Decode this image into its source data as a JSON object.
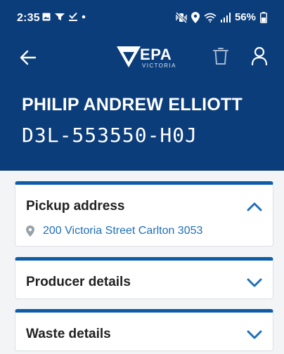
{
  "status_bar": {
    "time": "2:35",
    "battery": "56%",
    "left_icons": [
      "image-icon",
      "filter-icon",
      "check-download-icon",
      "dot-icon"
    ],
    "right_icons": [
      "mute-vibrate-icon",
      "location-icon",
      "wifi-icon",
      "signal-icon",
      "battery-icon"
    ]
  },
  "nav": {
    "logo_text": "EPA",
    "logo_subtitle": "VICTORIA",
    "icons": [
      "back-arrow-icon",
      "epa-logo",
      "trash-icon",
      "user-icon"
    ]
  },
  "record": {
    "name": "PHILIP ANDREW ELLIOTT",
    "id": "D3L-553550-H0J"
  },
  "sections": {
    "pickup": {
      "title": "Pickup address",
      "address": "200 Victoria Street Carlton 3053",
      "expanded": true
    },
    "producer": {
      "title": "Producer details",
      "expanded": false
    },
    "waste": {
      "title": "Waste details",
      "expanded": false
    }
  },
  "colors": {
    "header_bg": "#0b3d7a",
    "accent": "#0e5ba8",
    "link": "#1f6fb8",
    "page_bg": "#f3f4f6"
  }
}
